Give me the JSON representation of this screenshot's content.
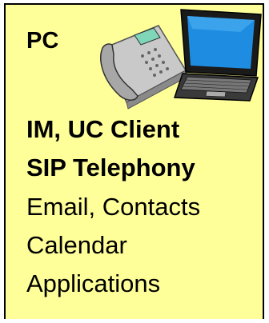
{
  "card": {
    "title": "PC",
    "background_color": "#ffff99",
    "lines": [
      {
        "text": "IM, UC Client",
        "bold": true
      },
      {
        "text": "SIP Telephony",
        "bold": true
      },
      {
        "text": "Email, Contacts",
        "bold": false
      },
      {
        "text": "Calendar",
        "bold": false
      },
      {
        "text": "Applications",
        "bold": false
      }
    ]
  },
  "clipart": [
    "desk-phone-icon",
    "laptop-icon"
  ]
}
